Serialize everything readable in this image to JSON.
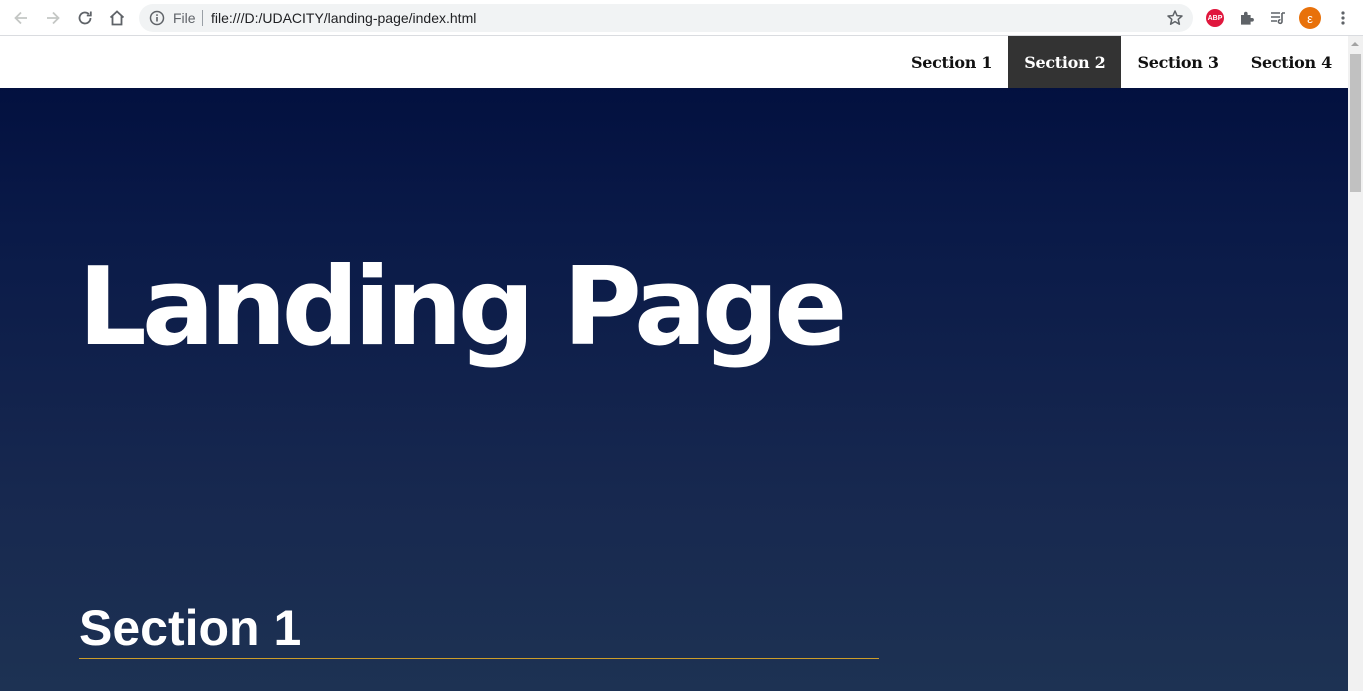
{
  "browser": {
    "scheme_label": "File",
    "url": "file:///D:/UDACITY/landing-page/index.html",
    "extensions": {
      "abp_label": "ABP",
      "profile_initial": "ε"
    },
    "icons": [
      "back-icon",
      "forward-icon",
      "reload-icon",
      "home-icon",
      "info-icon",
      "star-icon",
      "puzzle-icon",
      "media-icon",
      "kebab-menu-icon"
    ]
  },
  "page": {
    "nav": {
      "items": [
        {
          "label": "Section 1",
          "active": false
        },
        {
          "label": "Section 2",
          "active": true
        },
        {
          "label": "Section 3",
          "active": false
        },
        {
          "label": "Section 4",
          "active": false
        }
      ]
    },
    "hero": {
      "title": "Landing Page"
    },
    "sections": [
      {
        "heading": "Section 1"
      }
    ]
  },
  "colors": {
    "gradient_top": "#000d3c",
    "gradient_bottom": "#1d3253",
    "nav_active_bg": "#333333",
    "section_rule": "#cc9d2a",
    "abp_red": "#e0173d",
    "profile_orange": "#e8710a"
  }
}
